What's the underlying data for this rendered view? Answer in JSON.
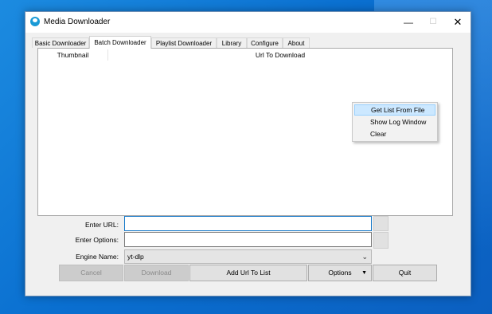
{
  "window": {
    "title": "Media Downloader",
    "minimize": "—",
    "maximize": "☐",
    "close": "✕"
  },
  "tabs": [
    {
      "label": "Basic Downloader",
      "active": false
    },
    {
      "label": "Batch Downloader",
      "active": true
    },
    {
      "label": "Playlist Downloader",
      "active": false
    },
    {
      "label": "Library",
      "active": false
    },
    {
      "label": "Configure",
      "active": false
    },
    {
      "label": "About",
      "active": false
    }
  ],
  "table": {
    "columns": [
      "Thumbnail",
      "Url To Download"
    ]
  },
  "context_menu": {
    "items": [
      {
        "label": "Get List From File",
        "highlighted": true
      },
      {
        "label": "Show Log Window",
        "highlighted": false
      },
      {
        "label": "Clear",
        "highlighted": false
      }
    ]
  },
  "form": {
    "url_label": "Enter URL:",
    "url_value": "",
    "options_label": "Enter Options:",
    "options_value": "",
    "engine_label": "Engine Name:",
    "engine_value": "yt-dlp"
  },
  "buttons": {
    "cancel": "Cancel",
    "download": "Download",
    "add_url": "Add Url To List",
    "options": "Options",
    "options_arrow": "▼",
    "quit": "Quit"
  },
  "icons": {
    "app": "app-logo-icon",
    "chevron": "chevron-down-icon"
  },
  "colors": {
    "accent": "#1679c9",
    "menu_highlight": "#cce8ff",
    "desktop": "#0b6fd0"
  }
}
